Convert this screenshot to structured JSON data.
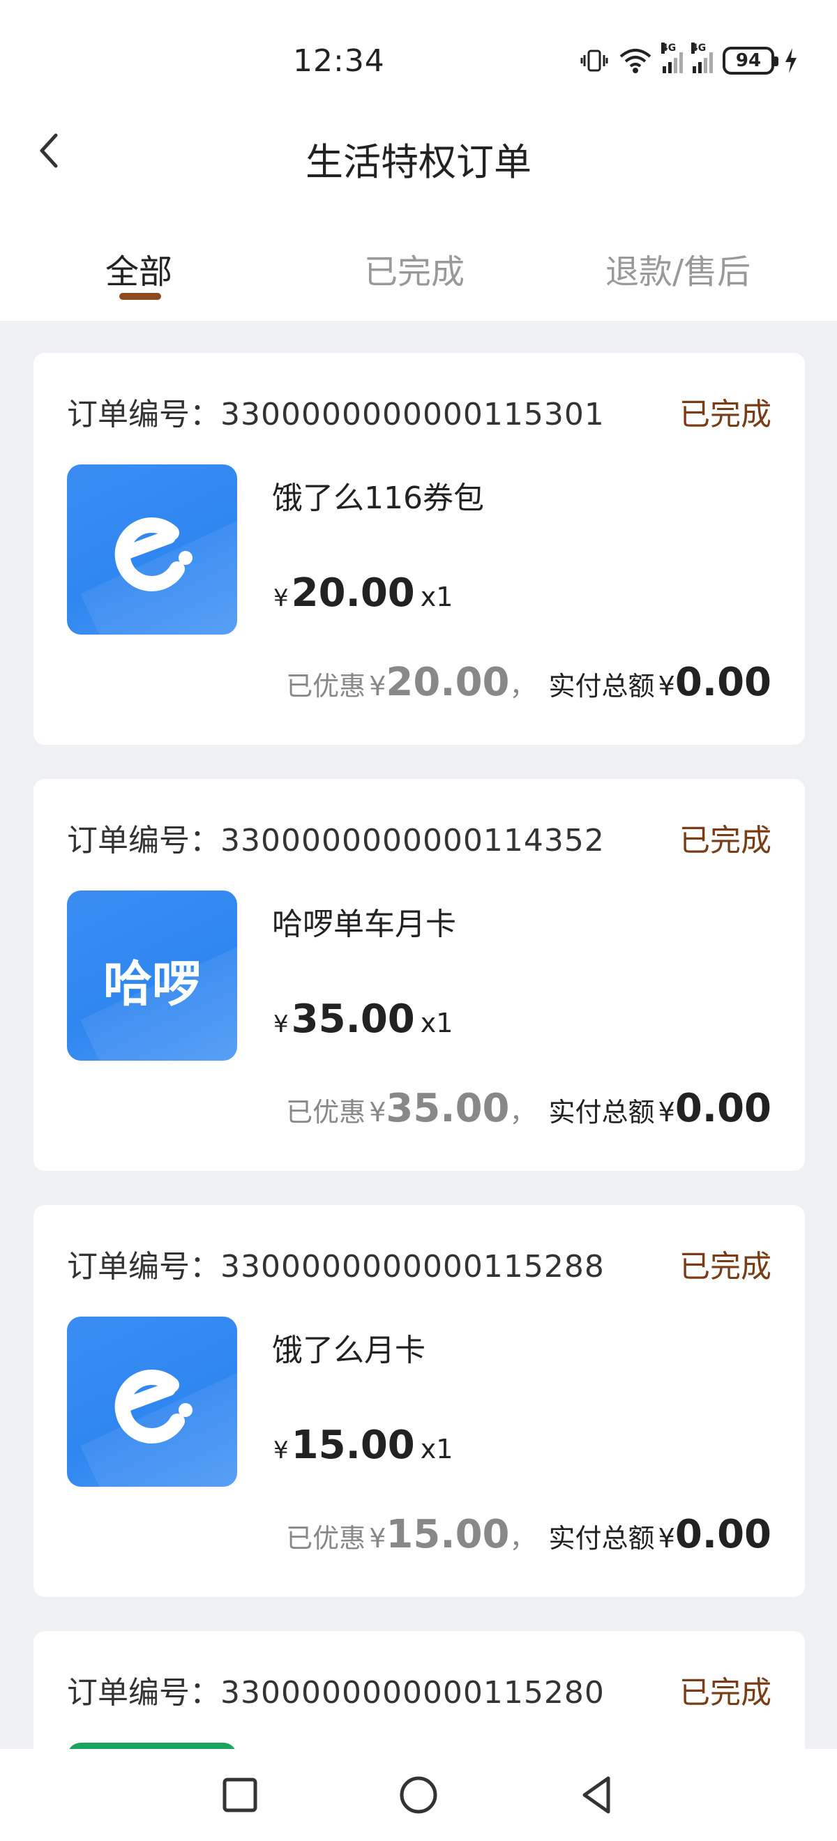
{
  "status_bar": {
    "time": "12:34",
    "battery": "94"
  },
  "header": {
    "title": "生活特权订单"
  },
  "tabs": [
    {
      "label": "全部",
      "active": true
    },
    {
      "label": "已完成",
      "active": false
    },
    {
      "label": "退款/售后",
      "active": false
    }
  ],
  "orders": [
    {
      "order_label": "订单编号：",
      "order_no": "3300000000000115301",
      "status": "已完成",
      "icon": "eleme-logo-icon",
      "name": "饿了么116券包",
      "currency": "¥",
      "price": "20.00",
      "qty": "x1",
      "discount_label": "已优惠",
      "discount": "20.00",
      "paid_label": "实付总额",
      "paid": "0.00",
      "separator": "，"
    },
    {
      "order_label": "订单编号：",
      "order_no": "3300000000000114352",
      "status": "已完成",
      "icon": "hellobike-logo-icon",
      "icon_text": "哈啰",
      "name": "哈啰单车月卡",
      "currency": "¥",
      "price": "35.00",
      "qty": "x1",
      "discount_label": "已优惠",
      "discount": "35.00",
      "paid_label": "实付总额",
      "paid": "0.00",
      "separator": "，"
    },
    {
      "order_label": "订单编号：",
      "order_no": "3300000000000115288",
      "status": "已完成",
      "icon": "eleme-logo-icon",
      "name": "饿了么月卡",
      "currency": "¥",
      "price": "15.00",
      "qty": "x1",
      "discount_label": "已优惠",
      "discount": "15.00",
      "paid_label": "实付总额",
      "paid": "0.00",
      "separator": "，"
    },
    {
      "order_label": "订单编号：",
      "order_no": "3300000000000115280",
      "status": "已完成"
    }
  ],
  "colors": {
    "accent": "#7a3c15",
    "tab_indicator": "#8b4a1f",
    "thumb_blue": "#2f86f0",
    "partial_thumb_green": "#1aa35a"
  }
}
